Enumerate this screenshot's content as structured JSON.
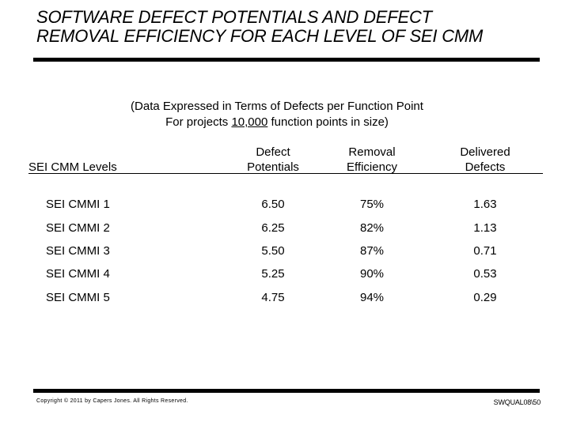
{
  "title": {
    "line1": "SOFTWARE DEFECT POTENTIALS AND DEFECT",
    "line2": "REMOVAL EFFICIENCY FOR EACH LEVEL OF SEI CMM"
  },
  "subtitle": {
    "line1": "(Data Expressed in Terms of Defects per Function Point",
    "line2_prefix": "For projects ",
    "line2_value": "10,000",
    "line2_suffix": " function points in size)"
  },
  "table": {
    "headers": {
      "levels": "SEI CMM Levels",
      "defect_potentials": [
        "Defect",
        "Potentials"
      ],
      "removal_efficiency": [
        "Removal",
        "Efficiency"
      ],
      "delivered_defects": [
        "Delivered",
        "Defects"
      ]
    },
    "rows": [
      {
        "level": "SEI CMMI 1",
        "defect_potentials": "6.50",
        "removal_efficiency": "75%",
        "delivered_defects": "1.63"
      },
      {
        "level": "SEI CMMI 2",
        "defect_potentials": "6.25",
        "removal_efficiency": "82%",
        "delivered_defects": "1.13"
      },
      {
        "level": "SEI CMMI 3",
        "defect_potentials": "5.50",
        "removal_efficiency": "87%",
        "delivered_defects": "0.71"
      },
      {
        "level": "SEI CMMI 4",
        "defect_potentials": "5.25",
        "removal_efficiency": "90%",
        "delivered_defects": "0.53"
      },
      {
        "level": "SEI CMMI 5",
        "defect_potentials": "4.75",
        "removal_efficiency": "94%",
        "delivered_defects": "0.29"
      }
    ]
  },
  "footer": {
    "copyright": "Copyright © 2011 by Capers Jones.  All Rights Reserved.",
    "reference": "SWQUAL08\\50"
  }
}
